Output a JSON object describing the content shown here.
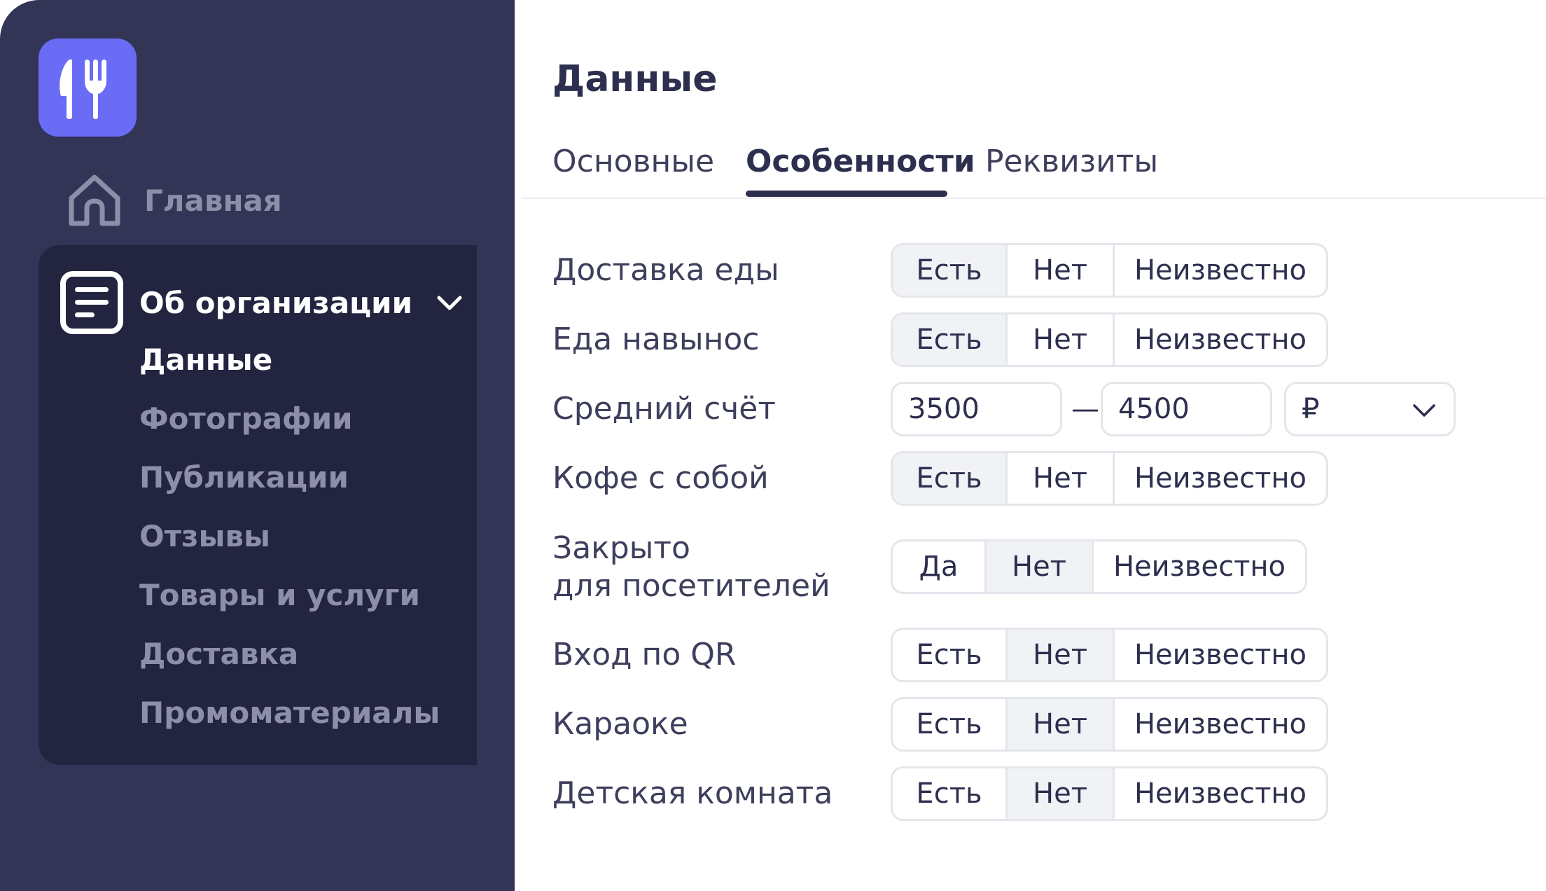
{
  "sidebar": {
    "logo_icon": "fork-knife-icon",
    "home": {
      "label": "Главная",
      "icon": "home-icon"
    },
    "org": {
      "label": "Об организации",
      "icon": "document-icon",
      "items": [
        {
          "label": "Данные",
          "active": true
        },
        {
          "label": "Фотографии"
        },
        {
          "label": "Публикации"
        },
        {
          "label": "Отзывы"
        },
        {
          "label": "Товары и услуги"
        },
        {
          "label": "Доставка"
        },
        {
          "label": "Промоматериалы"
        }
      ]
    }
  },
  "main": {
    "title": "Данные",
    "tabs": [
      {
        "label": "Основные"
      },
      {
        "label": "Особенности",
        "active": true
      },
      {
        "label": "Реквизиты"
      }
    ],
    "rows": [
      {
        "label": "Доставка еды",
        "options": [
          "Есть",
          "Нет",
          "Неизвестно"
        ],
        "selected": "Есть"
      },
      {
        "label": "Еда навынос",
        "options": [
          "Есть",
          "Нет",
          "Неизвестно"
        ],
        "selected": "Есть"
      },
      {
        "label": "Средний счёт",
        "from": "3500",
        "separator": "—",
        "to": "4500",
        "currency": "₽"
      },
      {
        "label": "Кофе с собой",
        "options": [
          "Есть",
          "Нет",
          "Неизвестно"
        ],
        "selected": "Есть"
      },
      {
        "label_line1": "Закрыто",
        "label_line2": "для посетителей",
        "options": [
          "Да",
          "Нет",
          "Неизвестно"
        ],
        "selected": "Нет"
      },
      {
        "label": "Вход по QR",
        "options": [
          "Есть",
          "Нет",
          "Неизвестно"
        ],
        "selected": "Нет"
      },
      {
        "label": "Караоке",
        "options": [
          "Есть",
          "Нет",
          "Неизвестно"
        ],
        "selected": "Нет"
      },
      {
        "label": "Детская комната",
        "options": [
          "Есть",
          "Нет",
          "Неизвестно"
        ],
        "selected": "Нет"
      }
    ]
  },
  "colors": {
    "sidebar_bg": "#333556",
    "panel_bg": "#232440",
    "logo_bg": "#6a6cf5",
    "selected_option_bg": "#f1f2f6"
  }
}
